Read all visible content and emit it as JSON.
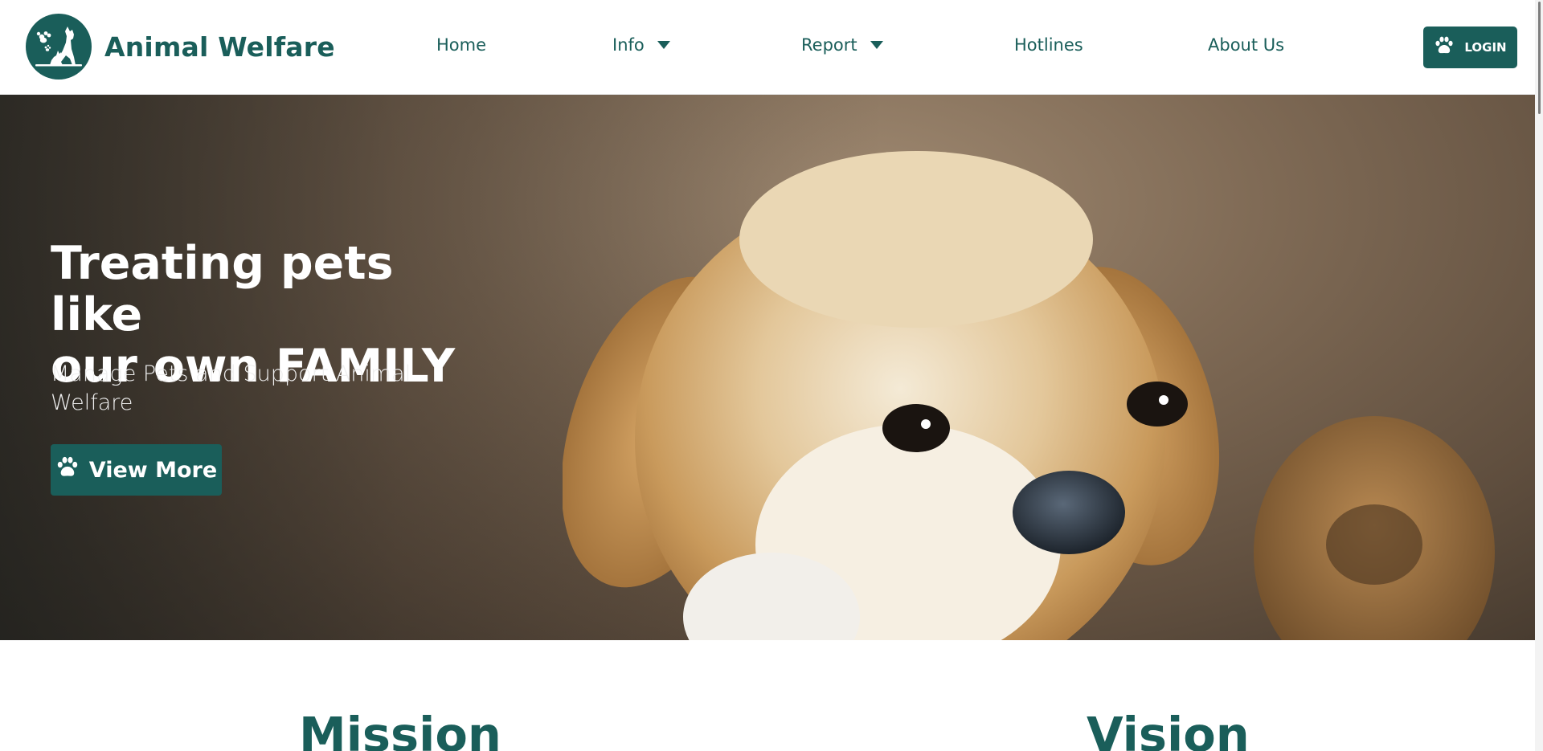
{
  "brand": {
    "name": "Animal Welfare",
    "logo_icon": "dog-cat-paw-logo",
    "color": "#1a5e5a"
  },
  "nav": {
    "items": [
      {
        "label": "Home",
        "has_dropdown": false
      },
      {
        "label": "Info",
        "has_dropdown": true
      },
      {
        "label": "Report",
        "has_dropdown": true
      },
      {
        "label": "Hotlines",
        "has_dropdown": false
      },
      {
        "label": "About Us",
        "has_dropdown": false
      }
    ],
    "login_label": "LOGIN",
    "login_icon": "paw-icon"
  },
  "hero": {
    "title_line1": "Treating pets like",
    "title_line2": "our own FAMILY",
    "subtitle": "Manage Pets and Support Animal Welfare",
    "button_label": "View More",
    "button_icon": "paw-icon",
    "image": "golden-puppy-photo"
  },
  "sections": {
    "mission_title": "Mission",
    "vision_title": "Vision"
  },
  "colors": {
    "accent": "#1a5e5a",
    "white": "#ffffff"
  }
}
